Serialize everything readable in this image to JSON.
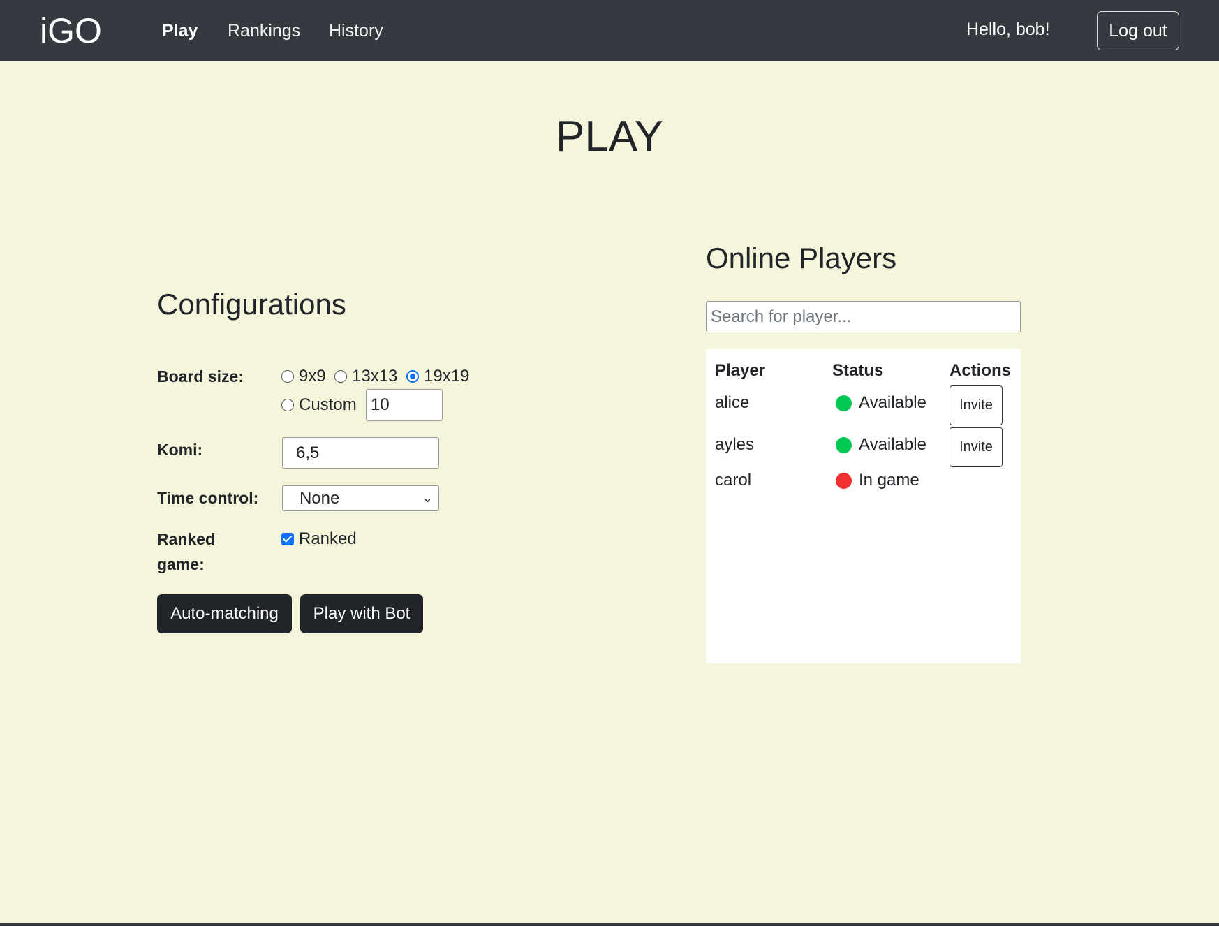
{
  "nav": {
    "brand": "iGO",
    "links": [
      {
        "label": "Play",
        "active": true
      },
      {
        "label": "Rankings",
        "active": false
      },
      {
        "label": "History",
        "active": false
      }
    ],
    "greeting": "Hello, bob!",
    "logout_label": "Log out"
  },
  "page_title": "PLAY",
  "config": {
    "title": "Configurations",
    "board_size": {
      "label": "Board size:",
      "options": [
        "9x9",
        "13x13",
        "19x19",
        "Custom"
      ],
      "selected": "19x19",
      "custom_value": "10"
    },
    "komi": {
      "label": "Komi:",
      "value": "6,5"
    },
    "time_control": {
      "label": "Time control:",
      "selected": "None"
    },
    "ranked": {
      "label": "Ranked game:",
      "checkbox_label": "Ranked",
      "checked": true
    },
    "auto_match_label": "Auto-matching",
    "play_bot_label": "Play with Bot"
  },
  "online": {
    "title": "Online Players",
    "search_placeholder": "Search for player...",
    "headers": {
      "player": "Player",
      "status": "Status",
      "actions": "Actions"
    },
    "invite_label": "Invite",
    "players": [
      {
        "name": "alice",
        "status": "Available",
        "status_color": "#00c853",
        "can_invite": true
      },
      {
        "name": "ayles",
        "status": "Available",
        "status_color": "#00c853",
        "can_invite": true
      },
      {
        "name": "carol",
        "status": "In game",
        "status_color": "#f03030",
        "can_invite": false
      }
    ]
  },
  "colors": {
    "background": "#f5f5dc",
    "navbar": "#343a40",
    "accent": "#0d6efd",
    "dark_button": "#212529"
  }
}
